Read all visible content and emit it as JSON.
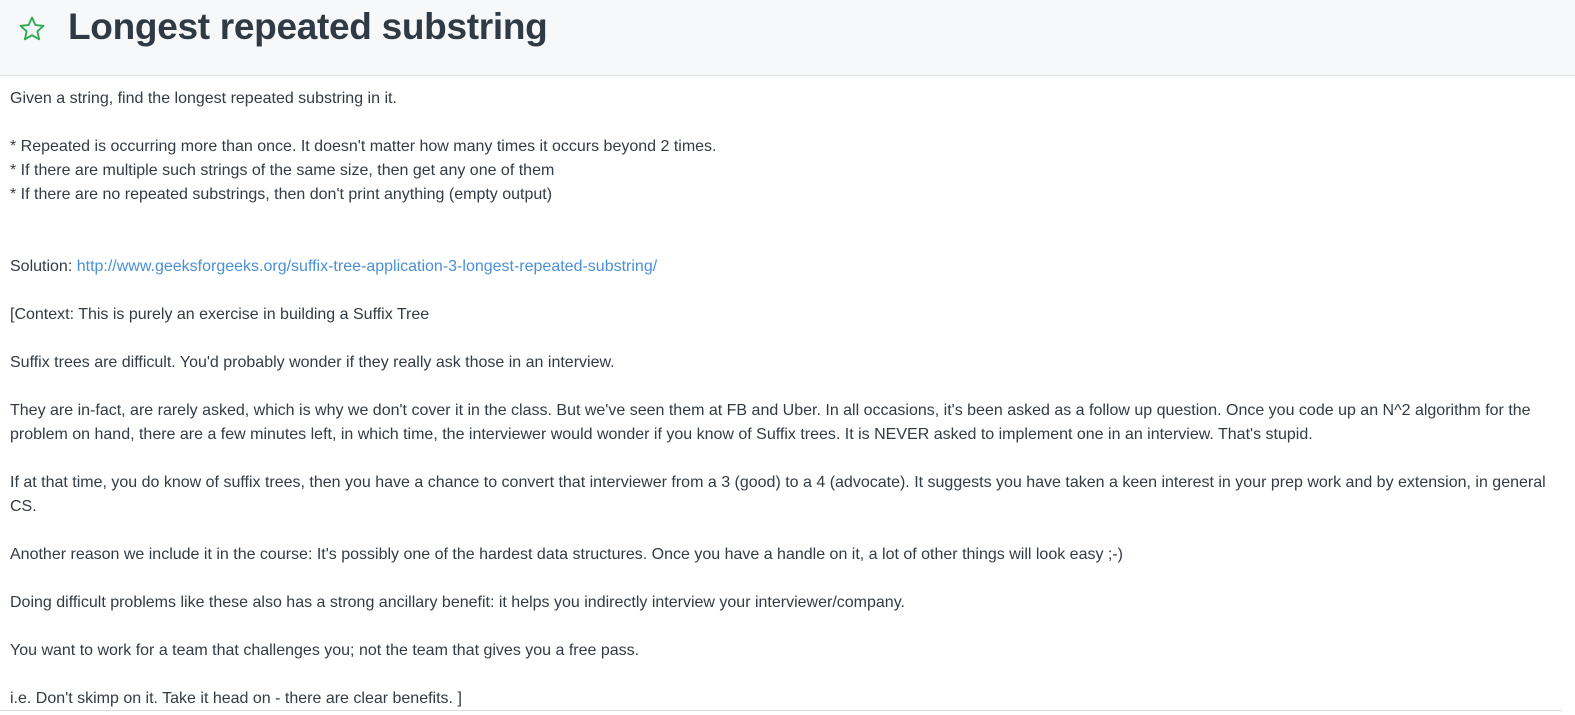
{
  "header": {
    "star_icon": "star-outline-icon",
    "star_color": "#2eaa4f",
    "title": "Longest repeated substring"
  },
  "problem": {
    "intro": "Given a string, find the longest repeated substring in it.",
    "rules": [
      "* Repeated is occurring more than once. It doesn't matter how many times it occurs beyond 2 times.",
      "* If there are multiple such strings of the same size, then get any one of them",
      "* If there are no repeated substrings, then don't print anything (empty output)"
    ],
    "solution_label": "Solution: ",
    "solution_link": "http://www.geeksforgeeks.org/suffix-tree-application-3-longest-repeated-substring/",
    "link_color": "#4a90d9",
    "paragraphs": [
      "[Context: This is purely an exercise in building a Suffix Tree",
      "Suffix trees are difficult. You'd probably wonder if they really ask those in an interview.",
      "They are in-fact, are rarely asked, which is why we don't cover it in the class. But we've seen them at FB and Uber. In all occasions, it's been asked as a follow up question. Once you code up an N^2 algorithm for the problem on hand, there are a few minutes left, in which time, the interviewer would wonder if you know of Suffix trees. It is NEVER asked to implement one in an interview. That's stupid.",
      "If at that time, you do know of suffix trees, then you have a chance to convert that interviewer from a 3 (good) to a 4 (advocate). It suggests you have taken a keen interest in your prep work and by extension, in general CS.",
      "Another reason we include it in the course: It's possibly one of the hardest data structures. Once you have a handle on it, a lot of other things will look easy ;-)",
      "Doing difficult problems like these also has a strong ancillary benefit: it helps you indirectly interview your interviewer/company.",
      "You want to work for a team that challenges you; not the team that gives you a free pass.",
      "i.e. Don't skimp on it. Take it head on - there are clear benefits. ]"
    ]
  }
}
